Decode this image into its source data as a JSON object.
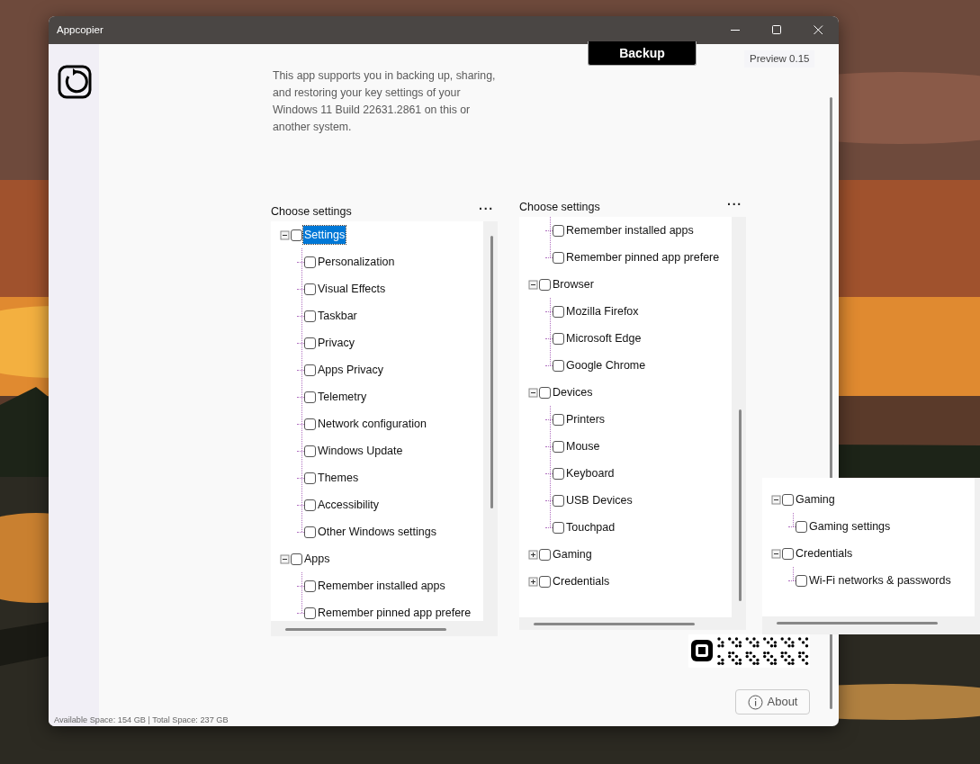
{
  "window": {
    "title": "Appcopier"
  },
  "description": "This app supports you in backing up, sharing, and restoring your key settings of your Windows 11 Build 22631.2861 on this or another system.",
  "backup_button": "Backup",
  "version": "Preview 0.15",
  "panels": [
    {
      "title": "Choose settings",
      "menu_button": "···",
      "items": [
        {
          "label": "Settings",
          "checked": false,
          "selected": true,
          "expanded": true,
          "children": [
            {
              "label": "Personalization",
              "checked": false,
              "selected": false
            },
            {
              "label": "Visual Effects",
              "checked": false,
              "selected": false
            },
            {
              "label": "Taskbar",
              "checked": false,
              "selected": false
            },
            {
              "label": "Privacy",
              "checked": false,
              "selected": false
            },
            {
              "label": "Apps Privacy",
              "checked": false,
              "selected": false
            },
            {
              "label": "Telemetry",
              "checked": false,
              "selected": false
            },
            {
              "label": "Network configuration",
              "checked": false,
              "selected": false
            },
            {
              "label": "Windows Update",
              "checked": false,
              "selected": false
            },
            {
              "label": "Themes",
              "checked": false,
              "selected": false
            },
            {
              "label": "Accessibility",
              "checked": false,
              "selected": false
            },
            {
              "label": "Other Windows settings",
              "checked": false,
              "selected": false
            }
          ]
        },
        {
          "label": "Apps",
          "checked": false,
          "selected": false,
          "expanded": true,
          "children": [
            {
              "label": "Remember installed apps",
              "checked": false,
              "selected": false
            },
            {
              "label": "Remember pinned app prefere",
              "checked": false,
              "selected": false
            }
          ]
        }
      ]
    },
    {
      "title": "Choose settings",
      "menu_button": "···",
      "items": [
        {
          "children": [
            {
              "label": "Remember installed apps",
              "checked": false,
              "selected": false
            },
            {
              "label": "Remember pinned app prefere",
              "checked": false,
              "selected": false
            }
          ]
        },
        {
          "label": "Browser",
          "checked": false,
          "selected": false,
          "expanded": true,
          "children": [
            {
              "label": "Mozilla Firefox",
              "checked": false,
              "selected": false
            },
            {
              "label": "Microsoft Edge",
              "checked": false,
              "selected": false
            },
            {
              "label": "Google Chrome",
              "checked": false,
              "selected": false
            }
          ]
        },
        {
          "label": "Devices",
          "checked": false,
          "selected": false,
          "expanded": true,
          "children": [
            {
              "label": "Printers",
              "checked": false,
              "selected": false
            },
            {
              "label": "Mouse",
              "checked": false,
              "selected": false
            },
            {
              "label": "Keyboard",
              "checked": false,
              "selected": false
            },
            {
              "label": "USB Devices",
              "checked": false,
              "selected": false
            },
            {
              "label": "Touchpad",
              "checked": false,
              "selected": false
            }
          ]
        },
        {
          "label": "Gaming",
          "checked": false,
          "selected": false,
          "expanded": false
        },
        {
          "label": "Credentials",
          "checked": false,
          "selected": false,
          "expanded": false
        }
      ]
    },
    {
      "items": [
        {
          "label": "Gaming",
          "checked": false,
          "selected": false,
          "expanded": true,
          "children": [
            {
              "label": "Gaming settings",
              "checked": false,
              "selected": false
            }
          ]
        },
        {
          "label": "Credentials",
          "checked": false,
          "selected": false,
          "expanded": true,
          "children": [
            {
              "label": "Wi-Fi networks & passwords",
              "checked": false,
              "selected": false
            }
          ]
        }
      ]
    }
  ],
  "about_button": "About",
  "status_bar": "Available Space: 154 GB | Total Space: 237 GB"
}
